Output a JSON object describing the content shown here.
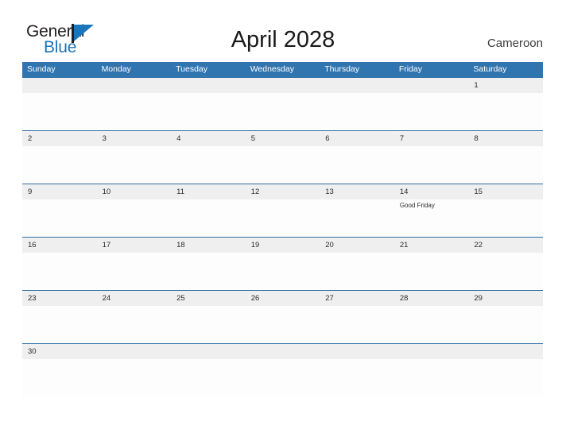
{
  "brand": {
    "name_part1": "General",
    "name_part2": "Blue",
    "flag_icon": "flag-triangle-icon",
    "color_dark": "#231f20",
    "color_blue": "#1b75bb"
  },
  "header": {
    "title": "April 2028",
    "region": "Cameroon"
  },
  "theme": {
    "header_blue": "#3175b0",
    "row_line_blue": "#2f6fa8",
    "date_band_gray": "#efefef",
    "cell_white": "#fdfdfd",
    "text_dark": "#2b2b2b"
  },
  "calendar": {
    "month": "April",
    "year": "2028",
    "day_headers": [
      "Sunday",
      "Monday",
      "Tuesday",
      "Wednesday",
      "Thursday",
      "Friday",
      "Saturday"
    ],
    "weeks": [
      {
        "days": [
          {
            "date": "",
            "event": ""
          },
          {
            "date": "",
            "event": ""
          },
          {
            "date": "",
            "event": ""
          },
          {
            "date": "",
            "event": ""
          },
          {
            "date": "",
            "event": ""
          },
          {
            "date": "",
            "event": ""
          },
          {
            "date": "1",
            "event": ""
          }
        ]
      },
      {
        "days": [
          {
            "date": "2",
            "event": ""
          },
          {
            "date": "3",
            "event": ""
          },
          {
            "date": "4",
            "event": ""
          },
          {
            "date": "5",
            "event": ""
          },
          {
            "date": "6",
            "event": ""
          },
          {
            "date": "7",
            "event": ""
          },
          {
            "date": "8",
            "event": ""
          }
        ]
      },
      {
        "days": [
          {
            "date": "9",
            "event": ""
          },
          {
            "date": "10",
            "event": ""
          },
          {
            "date": "11",
            "event": ""
          },
          {
            "date": "12",
            "event": ""
          },
          {
            "date": "13",
            "event": ""
          },
          {
            "date": "14",
            "event": "Good Friday"
          },
          {
            "date": "15",
            "event": ""
          }
        ]
      },
      {
        "days": [
          {
            "date": "16",
            "event": ""
          },
          {
            "date": "17",
            "event": ""
          },
          {
            "date": "18",
            "event": ""
          },
          {
            "date": "19",
            "event": ""
          },
          {
            "date": "20",
            "event": ""
          },
          {
            "date": "21",
            "event": ""
          },
          {
            "date": "22",
            "event": ""
          }
        ]
      },
      {
        "days": [
          {
            "date": "23",
            "event": ""
          },
          {
            "date": "24",
            "event": ""
          },
          {
            "date": "25",
            "event": ""
          },
          {
            "date": "26",
            "event": ""
          },
          {
            "date": "27",
            "event": ""
          },
          {
            "date": "28",
            "event": ""
          },
          {
            "date": "29",
            "event": ""
          }
        ]
      },
      {
        "days": [
          {
            "date": "30",
            "event": ""
          },
          {
            "date": "",
            "event": ""
          },
          {
            "date": "",
            "event": ""
          },
          {
            "date": "",
            "event": ""
          },
          {
            "date": "",
            "event": ""
          },
          {
            "date": "",
            "event": ""
          },
          {
            "date": "",
            "event": ""
          }
        ]
      }
    ]
  }
}
